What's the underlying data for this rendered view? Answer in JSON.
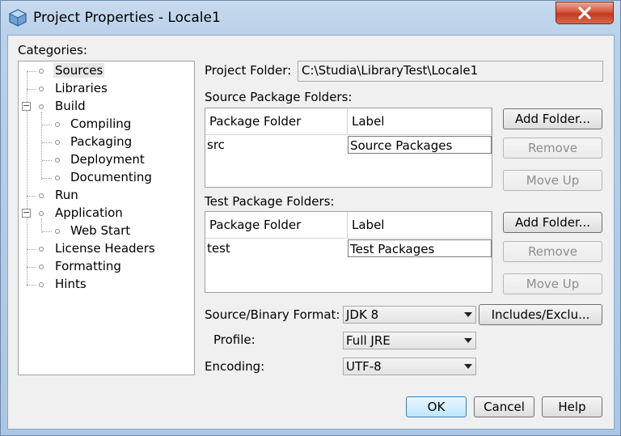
{
  "window": {
    "title": "Project Properties - Locale1"
  },
  "categories": {
    "label": "Categories:",
    "items": [
      {
        "label": "Sources"
      },
      {
        "label": "Libraries"
      },
      {
        "label": "Build"
      },
      {
        "label": "Compiling"
      },
      {
        "label": "Packaging"
      },
      {
        "label": "Deployment"
      },
      {
        "label": "Documenting"
      },
      {
        "label": "Run"
      },
      {
        "label": "Application"
      },
      {
        "label": "Web Start"
      },
      {
        "label": "License Headers"
      },
      {
        "label": "Formatting"
      },
      {
        "label": "Hints"
      }
    ]
  },
  "project_folder": {
    "label": "Project Folder:",
    "value": "C:\\Studia\\LibraryTest\\Locale1"
  },
  "source_packages": {
    "label": "Source Package Folders:",
    "columns": [
      "Package Folder",
      "Label"
    ],
    "rows": [
      [
        "src",
        "Source Packages"
      ]
    ],
    "add_button": "Add Folder...",
    "remove_button": "Remove",
    "move_up_button": "Move Up"
  },
  "test_packages": {
    "label": "Test Package Folders:",
    "columns": [
      "Package Folder",
      "Label"
    ],
    "rows": [
      [
        "test",
        "Test Packages"
      ]
    ],
    "add_button": "Add Folder...",
    "remove_button": "Remove",
    "move_up_button": "Move Up"
  },
  "source_binary_format": {
    "label": "Source/Binary Format:",
    "value": "JDK 8",
    "includes_button": "Includes/Exclu..."
  },
  "profile": {
    "label": "Profile:",
    "value": "Full JRE"
  },
  "encoding": {
    "label": "Encoding:",
    "value": "UTF-8"
  },
  "footer": {
    "ok": "OK",
    "cancel": "Cancel",
    "help": "Help"
  }
}
